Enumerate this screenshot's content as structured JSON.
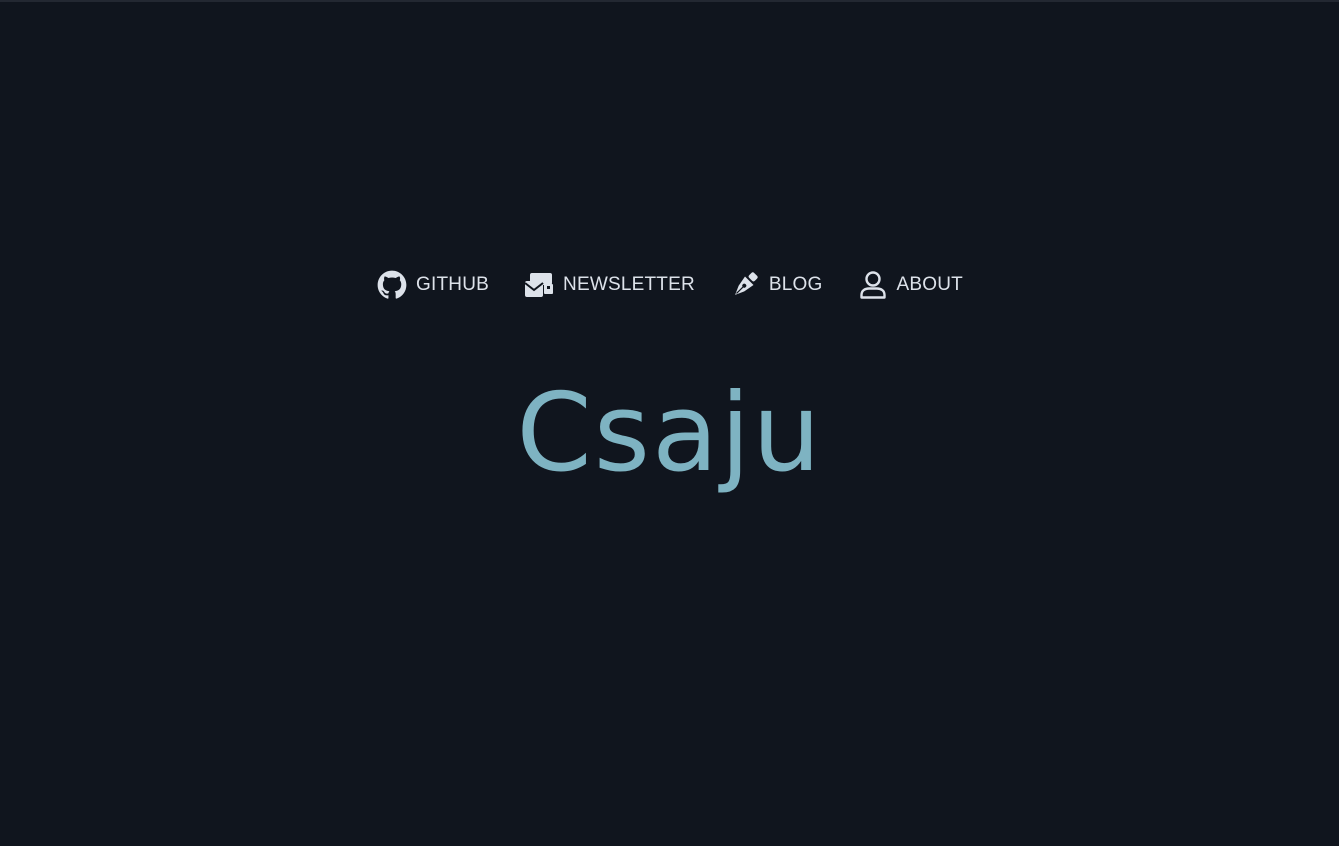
{
  "nav": {
    "items": [
      {
        "label": "GITHUB",
        "icon": "github-icon"
      },
      {
        "label": "NEWSLETTER",
        "icon": "newsletter-icon"
      },
      {
        "label": "BLOG",
        "icon": "pen-nib-icon"
      },
      {
        "label": "ABOUT",
        "icon": "user-icon"
      }
    ]
  },
  "brand": {
    "title": "Csaju"
  },
  "colors": {
    "background": "#10151e",
    "nav_text": "#dde2ea",
    "icon": "#dde2ea",
    "brand": "#7eb3c2"
  }
}
